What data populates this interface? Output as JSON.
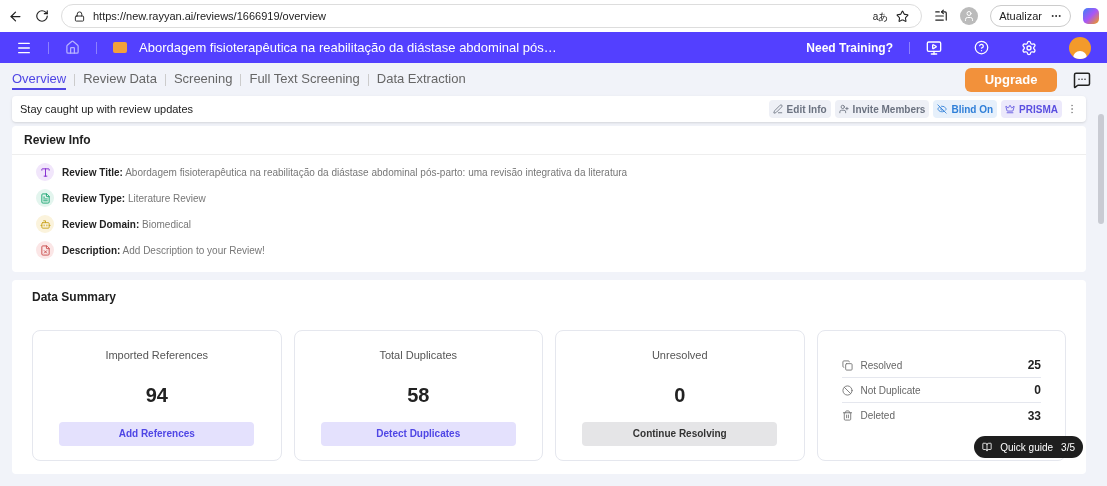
{
  "browser": {
    "url": "https://new.rayyan.ai/reviews/1666919/overview",
    "update_button": "Atualizar",
    "translate": "aあ"
  },
  "header": {
    "title": "Abordagem fisioterapêutica na reabilitação da diástase abdominal pós…",
    "training": "Need Training?"
  },
  "tabs": [
    {
      "label": "Overview",
      "selected": true
    },
    {
      "label": "Review Data",
      "selected": false
    },
    {
      "label": "Screening",
      "selected": false
    },
    {
      "label": "Full Text Screening",
      "selected": false
    },
    {
      "label": "Data Extraction",
      "selected": false
    }
  ],
  "upgrade_button": "Upgrade",
  "updates_bar": {
    "text": "Stay caught up with review updates",
    "actions": [
      {
        "kind": "edit",
        "label": "Edit Info"
      },
      {
        "kind": "invite",
        "label": "Invite Members"
      },
      {
        "kind": "blind",
        "label": "Blind On"
      },
      {
        "kind": "prisma",
        "label": "PRISMA"
      }
    ]
  },
  "review_info": {
    "title": "Review Info",
    "items": [
      {
        "kind": "title",
        "label": "Review Title:",
        "value": "Abordagem fisioterapêutica na reabilitação da diástase abdominal pós-parto: uma revisão integrativa da literatura"
      },
      {
        "kind": "type",
        "label": "Review Type:",
        "value": "Literature Review"
      },
      {
        "kind": "domain",
        "label": "Review Domain:",
        "value": "Biomedical"
      },
      {
        "kind": "description",
        "label": "Description:",
        "value": "Add Description to your Review!"
      }
    ]
  },
  "data_summary": {
    "title": "Data Summary",
    "stats": [
      {
        "label": "Imported References",
        "value": "94",
        "button": "Add References",
        "kind": "primary"
      },
      {
        "label": "Total Duplicates",
        "value": "58",
        "button": "Detect Duplicates",
        "kind": "primary"
      },
      {
        "label": "Unresolved",
        "value": "0",
        "button": "Continue Resolving",
        "kind": "muted"
      }
    ],
    "breakdown": [
      {
        "kind": "resolved",
        "label": "Resolved",
        "value": "25"
      },
      {
        "kind": "not_duplicate",
        "label": "Not Duplicate",
        "value": "0"
      },
      {
        "kind": "deleted",
        "label": "Deleted",
        "value": "33"
      }
    ]
  },
  "quick_guide": {
    "label": "Quick guide",
    "progress": "3/5"
  }
}
